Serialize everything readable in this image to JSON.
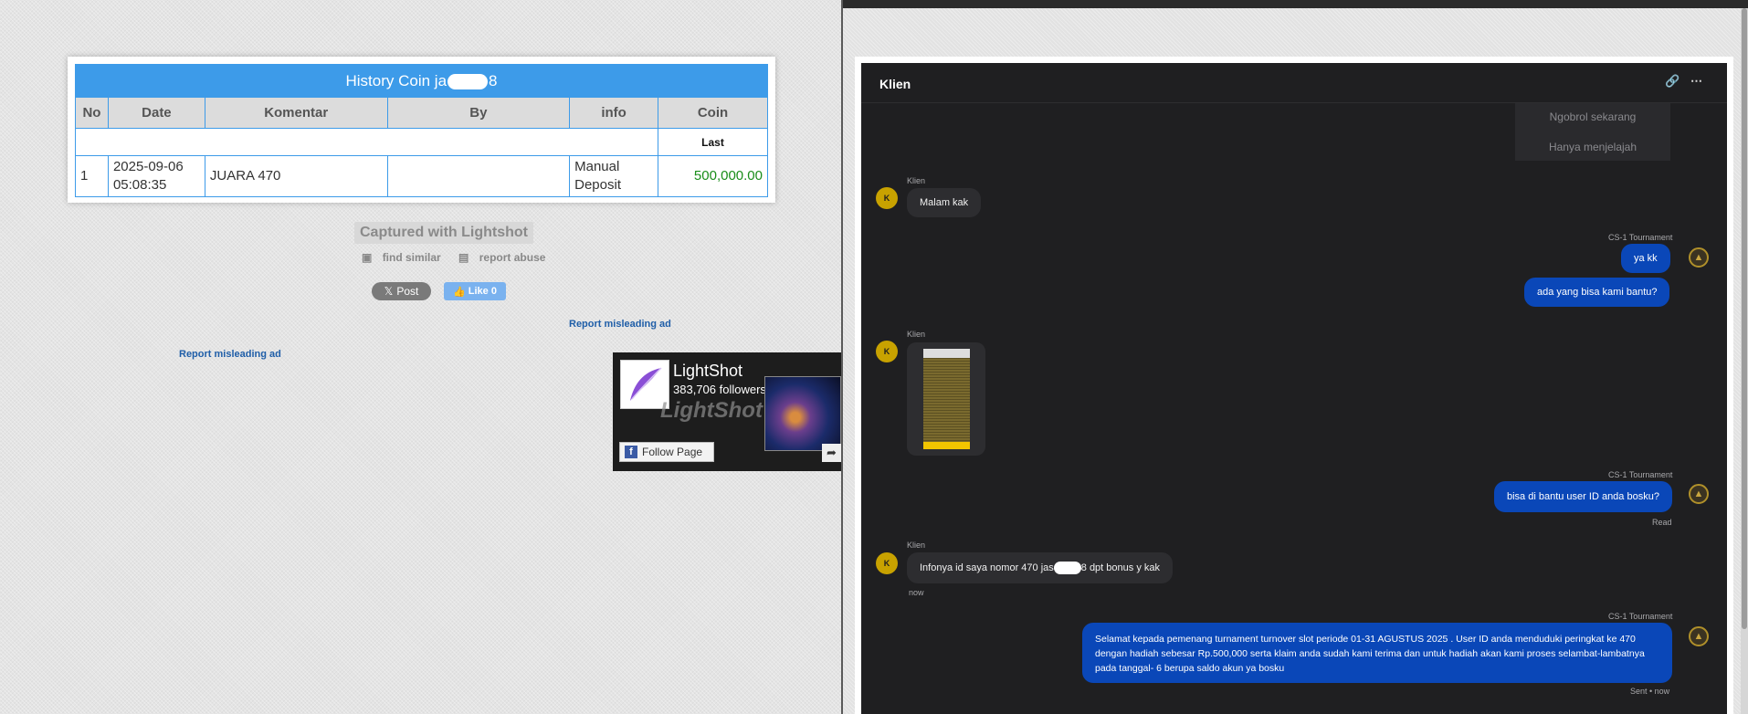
{
  "history": {
    "title_prefix": "History Coin ja",
    "title_suffix": "8",
    "headers": [
      "No",
      "Date",
      "Komentar",
      "By",
      "info",
      "Coin"
    ],
    "last_label": "Last",
    "row": {
      "no": "1",
      "date_line1": "2025-09-06",
      "date_line2": "05:08:35",
      "komentar": "JUARA 470",
      "by": "",
      "info_line1": "Manual",
      "info_line2": "Deposit",
      "coin": "500,000.00"
    }
  },
  "lightshot": {
    "captured": "Captured with Lightshot",
    "find_similar": "find similar",
    "report_abuse": "report abuse",
    "post_label": "Post",
    "like_label": "Like 0",
    "report_ad_1": "Report misleading ad",
    "report_ad_2": "Report misleading ad",
    "fb_page_name": "LightShot",
    "fb_followers": "383,706 followers",
    "fb_watermark": "LightShot",
    "fb_follow_label": "Follow Page"
  },
  "chat": {
    "title": "Klien",
    "quick_replies": [
      "Ngobrol sekarang",
      "Hanya menjelajah"
    ],
    "messages": [
      {
        "sender": "Klien",
        "avatar": "K",
        "text": "Malam kak"
      },
      {
        "sender": "CS-1 Tournament",
        "text": "ya kk"
      },
      {
        "sender": "",
        "text": "ada yang bisa kami bantu?"
      },
      {
        "sender": "Klien",
        "avatar": "K",
        "text": "[image]"
      },
      {
        "sender": "CS-1 Tournament",
        "text": "bisa di bantu user ID anda bosku?",
        "status": "Read"
      },
      {
        "sender": "Klien",
        "avatar": "K",
        "text_prefix": "Infonya id saya nomor 470 jas",
        "text_suffix": "8 dpt bonus y kak",
        "status": "now"
      },
      {
        "sender": "CS-1 Tournament",
        "text": "Selamat kepada pemenang turnament turnover slot periode 01-31 AGUSTUS 2025 . User ID anda menduduki peringkat ke 470 dengan hadiah sebesar Rp.500,000 serta klaim anda sudah kami terima dan untuk hadiah akan kami proses selambat-lambatnya pada tanggal- 6 berupa saldo akun ya bosku",
        "status": "Sent • now"
      }
    ]
  },
  "colors": {
    "table_header_blue": "#3d9be9",
    "coin_green": "#198d19",
    "chat_bg": "#1f1f21",
    "outgoing_bubble": "#0a47b8",
    "incoming_bubble": "#2d2d30",
    "avatar_gold": "#c8a200"
  }
}
